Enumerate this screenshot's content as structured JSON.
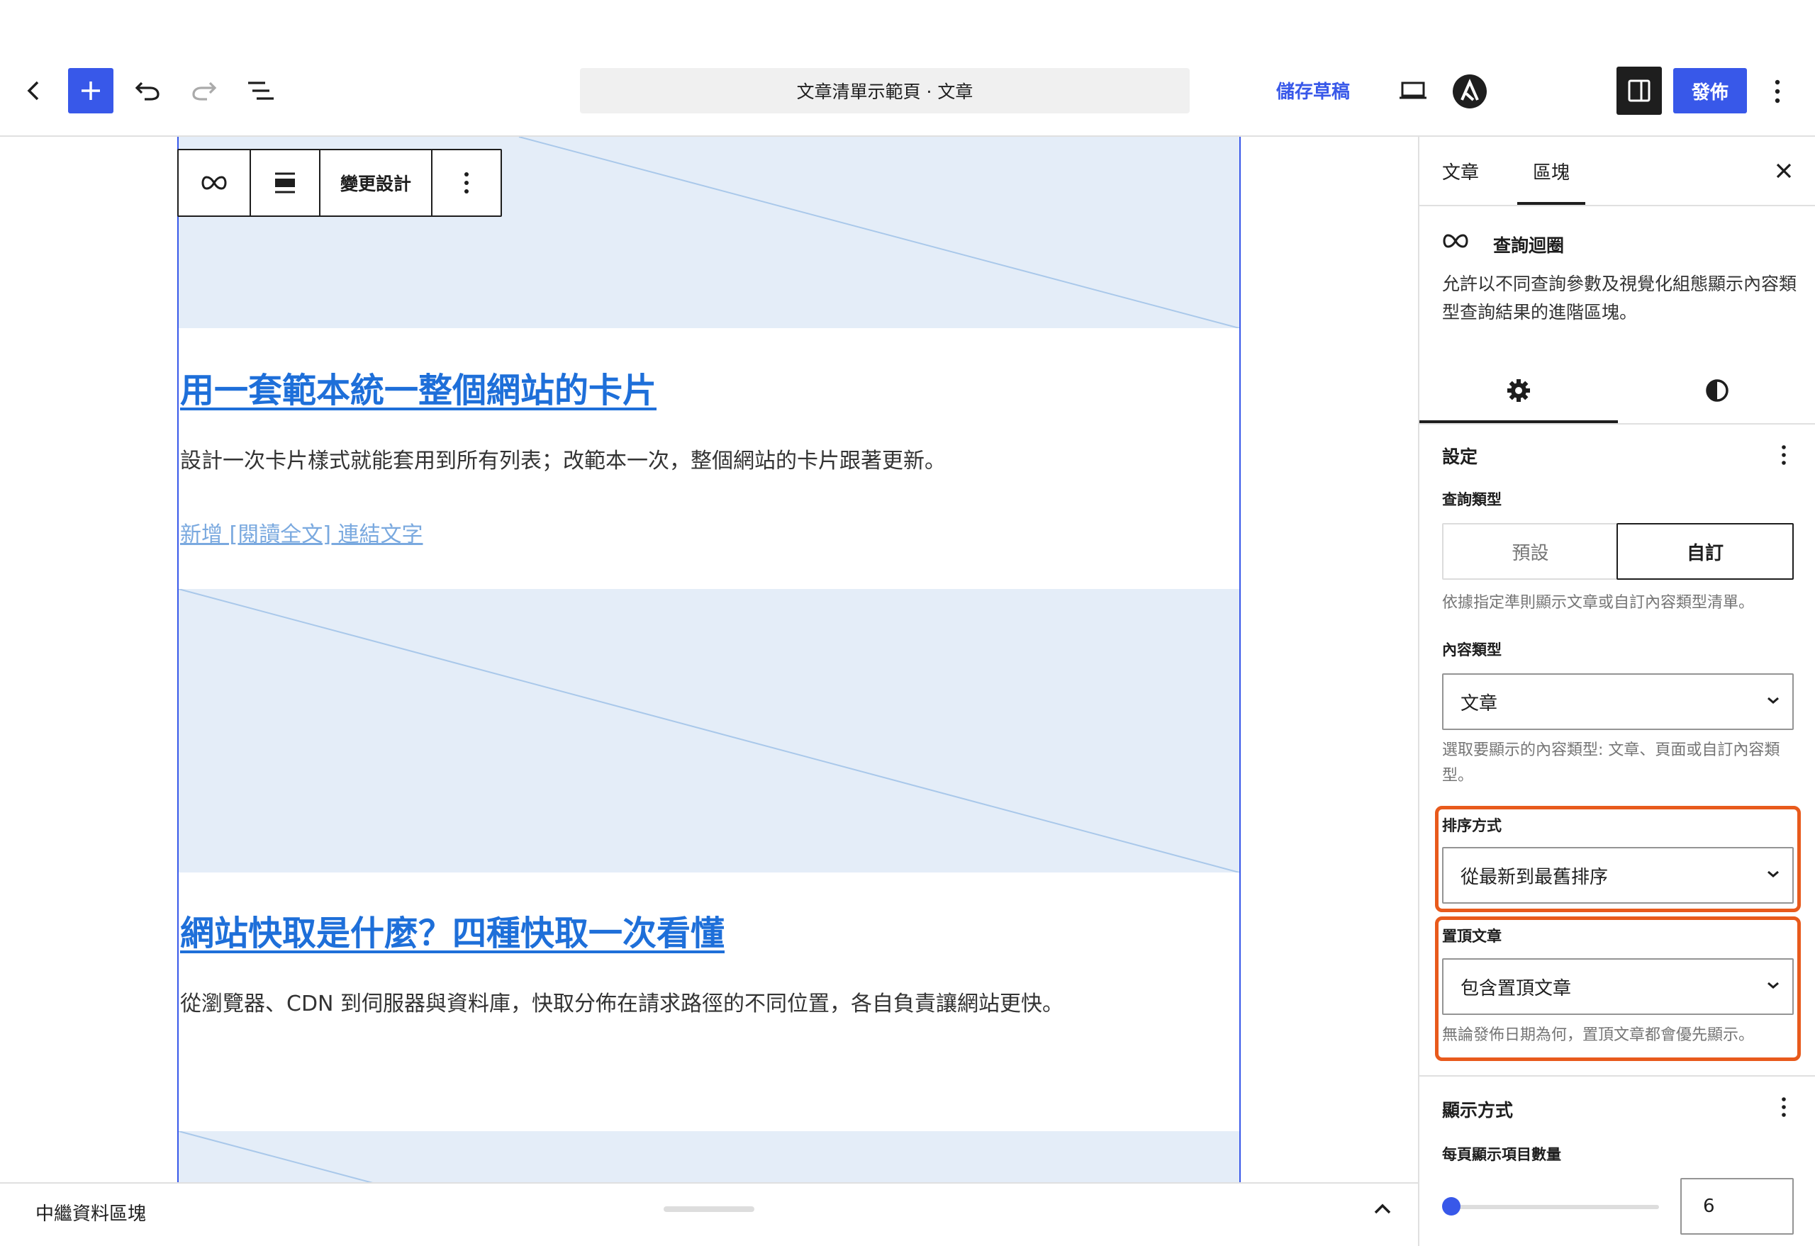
{
  "topbar": {
    "document_title": "文章清單示範頁 · 文章",
    "save_draft_label": "儲存草稿",
    "publish_label": "發佈",
    "icons": [
      "back-icon",
      "add-icon",
      "undo-icon",
      "redo-icon",
      "list-view-icon",
      "preview-device-icon",
      "astra-logo-icon",
      "sidebar-toggle-icon",
      "more-options-icon"
    ]
  },
  "block_toolbar": {
    "change_design_label": "變更設計",
    "icons": [
      "query-loop-icon",
      "align-icon",
      "more-options-icon"
    ]
  },
  "posts": [
    {
      "title": "用一套範本統一整個網站的卡片",
      "excerpt": "設計一次卡片樣式就能套用到所有列表；改範本一次，整個網站的卡片跟著更新。",
      "read_more": "新增 [閱讀全文] 連結文字"
    },
    {
      "title": "網站快取是什麼？四種快取一次看懂",
      "excerpt": "從瀏覽器、CDN 到伺服器與資料庫，快取分佈在請求路徑的不同位置，各自負責讓網站更快。"
    }
  ],
  "footer": {
    "breadcrumb": "中繼資料區塊"
  },
  "sidebar": {
    "tabs": [
      {
        "label": "文章",
        "active": false
      },
      {
        "label": "區塊",
        "active": true
      }
    ],
    "block": {
      "name": "查詢迴圈",
      "description": "允許以不同查詢參數及視覺化組態顯示內容類型查詢結果的進階區塊。"
    },
    "settings": {
      "title": "設定",
      "query_type_label": "查詢類型",
      "query_type_options": [
        "預設",
        "自訂"
      ],
      "query_type_selected": "自訂",
      "query_type_help": "依據指定準則顯示文章或自訂內容類型清單。",
      "post_type_label": "內容類型",
      "post_type_value": "文章",
      "post_type_help": "選取要顯示的內容類型: 文章、頁面或自訂內容類型。",
      "order_label": "排序方式",
      "order_value": "從最新到最舊排序",
      "sticky_label": "置頂文章",
      "sticky_value": "包含置頂文章",
      "sticky_help": "無論發佈日期為何，置頂文章都會優先顯示。"
    },
    "display": {
      "title": "顯示方式",
      "items_per_page_label": "每頁顯示項目數量",
      "items_per_page_value": "6",
      "slider_fraction": 0.0
    },
    "colors": {
      "accent": "#3858e9",
      "highlight": "#e85a1c"
    }
  }
}
